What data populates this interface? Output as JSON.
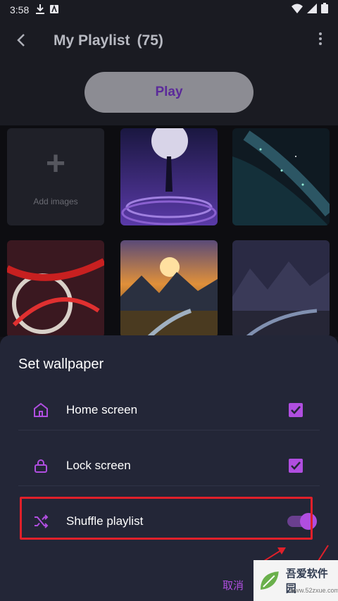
{
  "status": {
    "time": "3:58"
  },
  "appbar": {
    "title": "My Playlist",
    "count": "(75)"
  },
  "play": {
    "label": "Play"
  },
  "grid": {
    "add_label": "Add images"
  },
  "sheet": {
    "title": "Set wallpaper",
    "options": [
      {
        "label": "Home screen",
        "checked": true
      },
      {
        "label": "Lock screen",
        "checked": true
      },
      {
        "label": "Shuffle playlist",
        "toggled": true
      }
    ],
    "cancel_label": "取消"
  },
  "watermark": {
    "text": "吾爱软件园",
    "url": "www.52zxue.com"
  },
  "colors": {
    "accent": "#b04ee0",
    "sheet_bg": "#232637",
    "highlight": "#e0202a"
  }
}
